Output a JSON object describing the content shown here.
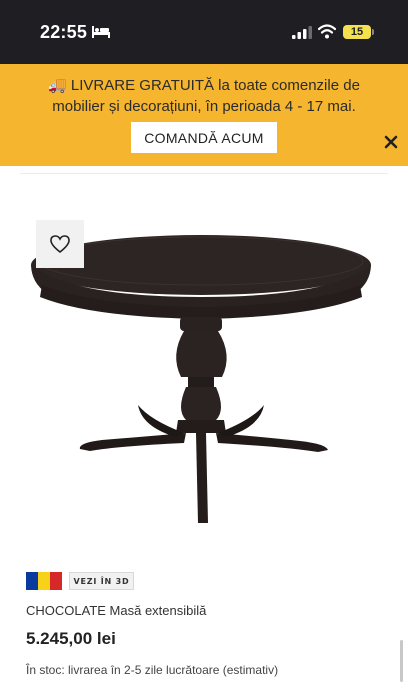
{
  "status_bar": {
    "time": "22:55",
    "battery": "15",
    "icons": [
      "bed-icon",
      "signal-icon",
      "wifi-icon",
      "battery-icon"
    ]
  },
  "promo": {
    "icon": "truck-icon",
    "text": "LIVRARE GRATUITĂ la toate comenzile de mobilier și decorațiuni, în perioada 4 - 17 mai.",
    "cta": "COMANDĂ ACUM",
    "close_icon": "close-icon",
    "background": "#f5b52e"
  },
  "product": {
    "wishlist_icon": "heart-icon",
    "flag": [
      "#0a3a9e",
      "#f7d218",
      "#d62828"
    ],
    "view_3d": "VEZI ÎN 3D",
    "name": "CHOCOLATE Masă extensibilă",
    "price": "5.245,00 lei",
    "stock": "În stoc: livrarea în 2-5 zile lucrătoare (estimativ)"
  }
}
